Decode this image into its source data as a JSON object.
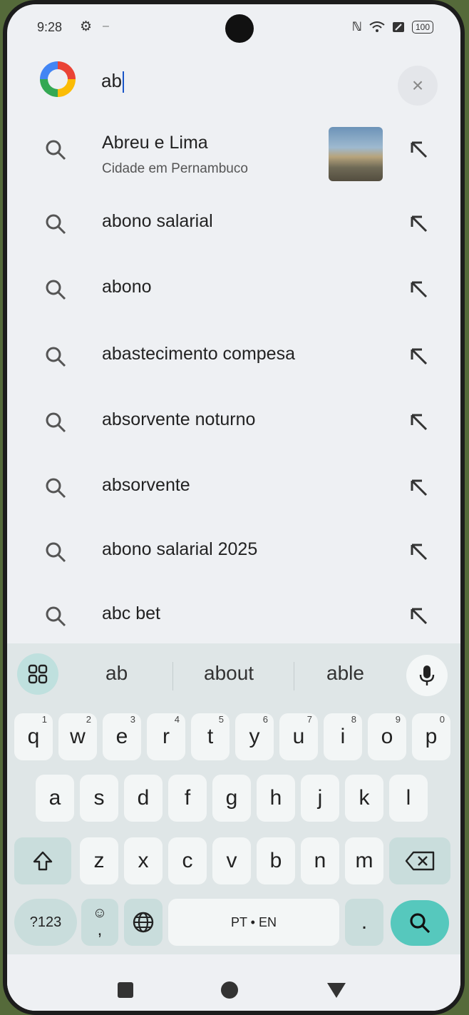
{
  "status_bar": {
    "time": "9:28",
    "icons": [
      "gear-icon",
      "nfc-icon",
      "wifi-icon",
      "sim-icon",
      "battery-icon"
    ],
    "nfc_label": "ℕ",
    "battery": "100"
  },
  "search": {
    "query": "ab",
    "logo": "google-logo",
    "clear_label": "×"
  },
  "suggestions": [
    {
      "label": "Abreu e Lima",
      "sublabel": "Cidade em Pernambuco",
      "has_image": true
    },
    {
      "label": "abono salarial"
    },
    {
      "label": "abono"
    },
    {
      "label": "abastecimento compesa"
    },
    {
      "label": "absorvente noturno"
    },
    {
      "label": "absorvente"
    },
    {
      "label": "abono salarial 2025"
    },
    {
      "label": "abc bet"
    }
  ],
  "keyboard": {
    "word_suggestions": [
      "ab",
      "about",
      "able"
    ],
    "row1": [
      {
        "key": "q",
        "sup": "1"
      },
      {
        "key": "w",
        "sup": "2"
      },
      {
        "key": "e",
        "sup": "3"
      },
      {
        "key": "r",
        "sup": "4"
      },
      {
        "key": "t",
        "sup": "5"
      },
      {
        "key": "y",
        "sup": "6"
      },
      {
        "key": "u",
        "sup": "7"
      },
      {
        "key": "i",
        "sup": "8"
      },
      {
        "key": "o",
        "sup": "9"
      },
      {
        "key": "p",
        "sup": "0"
      }
    ],
    "row2": [
      "a",
      "s",
      "d",
      "f",
      "g",
      "h",
      "j",
      "k",
      "l"
    ],
    "row3": [
      "z",
      "x",
      "c",
      "v",
      "b",
      "n",
      "m"
    ],
    "symbols_label": "?123",
    "emoji_label": "☺",
    "comma_label": ",",
    "space_label": "PT • EN",
    "period_label": "."
  },
  "colors": {
    "accent": "#56c8bd",
    "keyboard_bg": "#dfe6e7",
    "key_bg": "#f3f6f6"
  }
}
